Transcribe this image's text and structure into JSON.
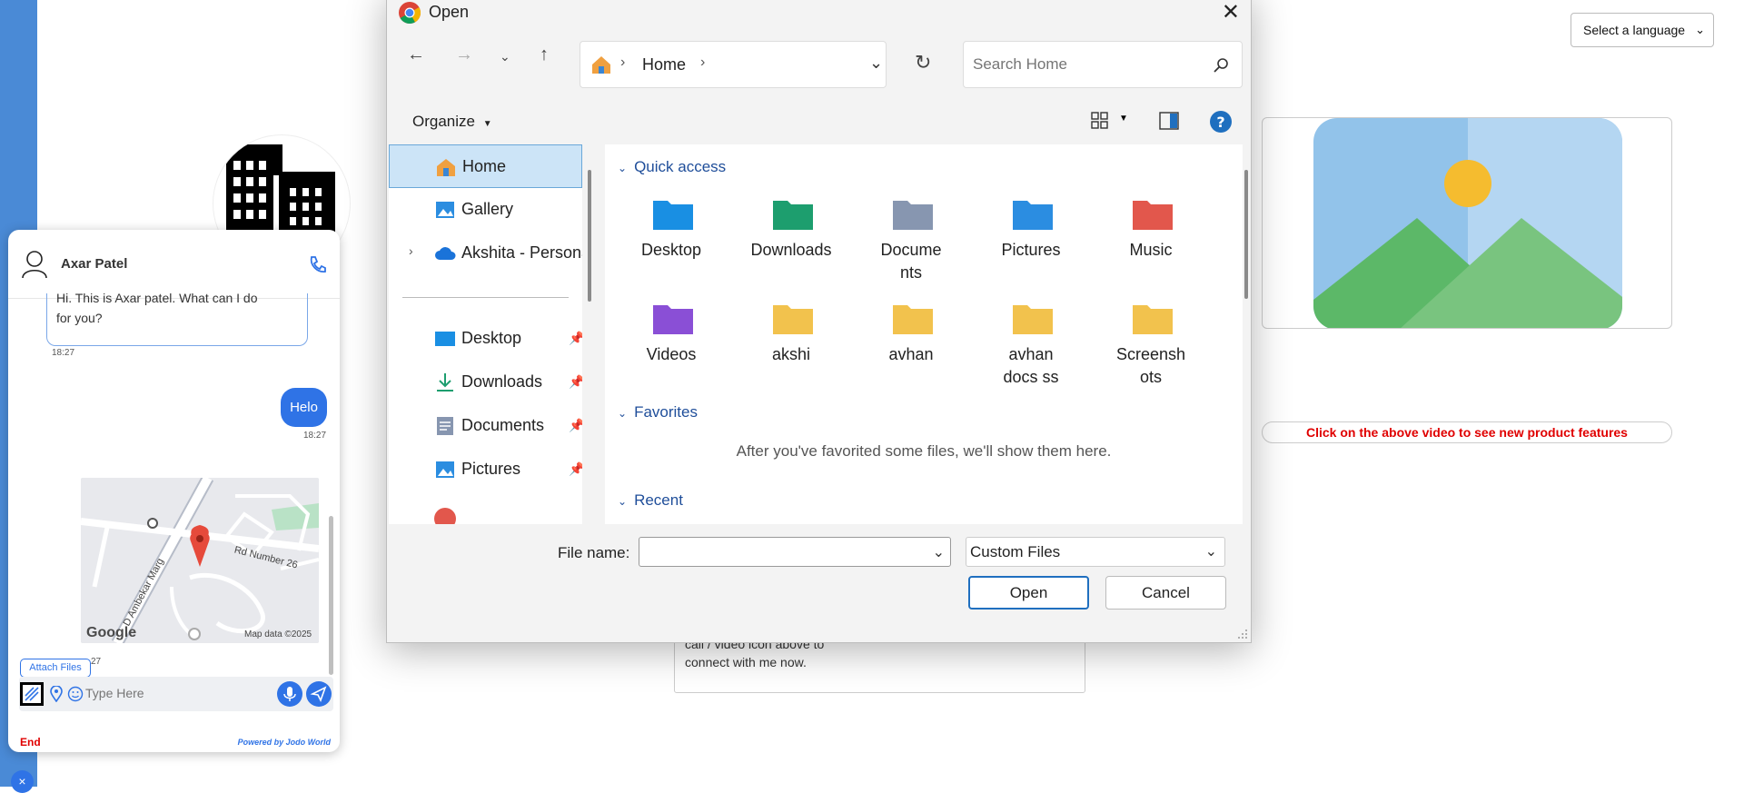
{
  "language_select": {
    "label": "Select a language"
  },
  "banner": {
    "text": "Click on the above video to see new product features"
  },
  "behind_box": {
    "line1": "call / video icon above to",
    "line2": "connect with me now."
  },
  "chat": {
    "agent_name": "Axar Patel",
    "incoming_partial": "Hi. This is Axar patel. What can I do",
    "incoming_line2": "for you?",
    "incoming_time": "18:27",
    "outgoing_text": "Helo",
    "outgoing_time": "18:27",
    "map_road1": "Rd Number 26",
    "map_road2": "D Ambekar Marg",
    "map_attrib": "Map data ©2025",
    "map_logo": "Google",
    "map_time_partial": "27",
    "attach_label": "Attach Files",
    "input_placeholder": "Type Here",
    "end_label": "End",
    "powered_by": "Powered by Jodo World",
    "close_fab": "×"
  },
  "dialog": {
    "title": "Open",
    "address": {
      "location": "Home",
      "sep": "›"
    },
    "search_placeholder": "Search Home",
    "organize_label": "Organize",
    "nav": {
      "home": "Home",
      "gallery": "Gallery",
      "onedrive": "Akshita - Personal",
      "desktop": "Desktop",
      "downloads": "Downloads",
      "documents": "Documents",
      "pictures": "Pictures"
    },
    "sections": {
      "quick_access": "Quick access",
      "favorites": "Favorites",
      "recent": "Recent",
      "favorites_empty": "After you've favorited some files, we'll show them here."
    },
    "folders": [
      {
        "line1": "Desktop",
        "line2": "",
        "color": "#1a8fe3"
      },
      {
        "line1": "Downloads",
        "line2": "",
        "color": "#1d9e6f"
      },
      {
        "line1": "Docume",
        "line2": "nts",
        "color": "#8796b0"
      },
      {
        "line1": "Pictures",
        "line2": "",
        "color": "#2b8de0"
      },
      {
        "line1": "Music",
        "line2": "",
        "color": "#e2574c"
      },
      {
        "line1": "Videos",
        "line2": "",
        "color": "#8a4fd6"
      },
      {
        "line1": "akshi",
        "line2": "",
        "color": "#f2c24d"
      },
      {
        "line1": "avhan",
        "line2": "",
        "color": "#f2c24d"
      },
      {
        "line1": "avhan",
        "line2": "docs ss",
        "color": "#f2c24d"
      },
      {
        "line1": "Screensh",
        "line2": "ots",
        "color": "#f2c24d"
      }
    ],
    "file_name_label": "File name:",
    "file_name_value": "",
    "file_type": "Custom Files",
    "open_button": "Open",
    "cancel_button": "Cancel"
  }
}
